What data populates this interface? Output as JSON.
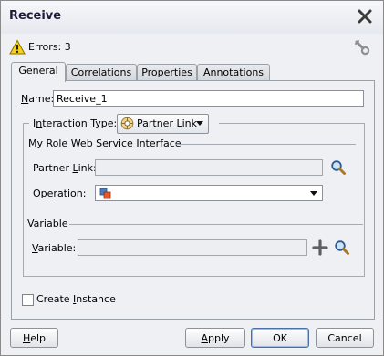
{
  "window": {
    "title": "Receive"
  },
  "status": {
    "errors_label": "Errors: 3"
  },
  "tabs": [
    {
      "label": "General",
      "active": true
    },
    {
      "label": "Correlations",
      "active": false
    },
    {
      "label": "Properties",
      "active": false
    },
    {
      "label": "Annotations",
      "active": false
    }
  ],
  "general": {
    "name": {
      "label_key": "N",
      "label_rest": "ame:",
      "value": "Receive_1"
    },
    "interaction_type": {
      "label_pre": "I",
      "label_key": "n",
      "label_rest": "teraction Type:",
      "value": "Partner Link"
    },
    "my_role_section": {
      "label": "My Role Web Service Interface"
    },
    "partner_link": {
      "label_pre": "Partner ",
      "label_key": "L",
      "label_rest": "ink:",
      "value": ""
    },
    "operation": {
      "label_pre": "Op",
      "label_key": "e",
      "label_rest": "ration:",
      "value": ""
    },
    "variable_section": {
      "label": "Variable"
    },
    "variable": {
      "label_pre": "",
      "label_key": "V",
      "label_rest": "ariable:",
      "value": ""
    },
    "create_instance": {
      "label_pre": "Create ",
      "label_key": "I",
      "label_rest": "nstance",
      "checked": false
    }
  },
  "buttons": {
    "help": {
      "key": "H",
      "rest": "elp"
    },
    "apply": {
      "key": "A",
      "rest": "pply"
    },
    "ok": {
      "label": "OK"
    },
    "cancel": {
      "label": "Cancel"
    }
  },
  "icons": {
    "close": "close-icon",
    "warning": "warning-icon",
    "wrench": "wrench-icon",
    "partner_link_type": "partner-link-icon",
    "operation": "operation-icon",
    "search": "search-icon",
    "add": "plus-icon"
  }
}
